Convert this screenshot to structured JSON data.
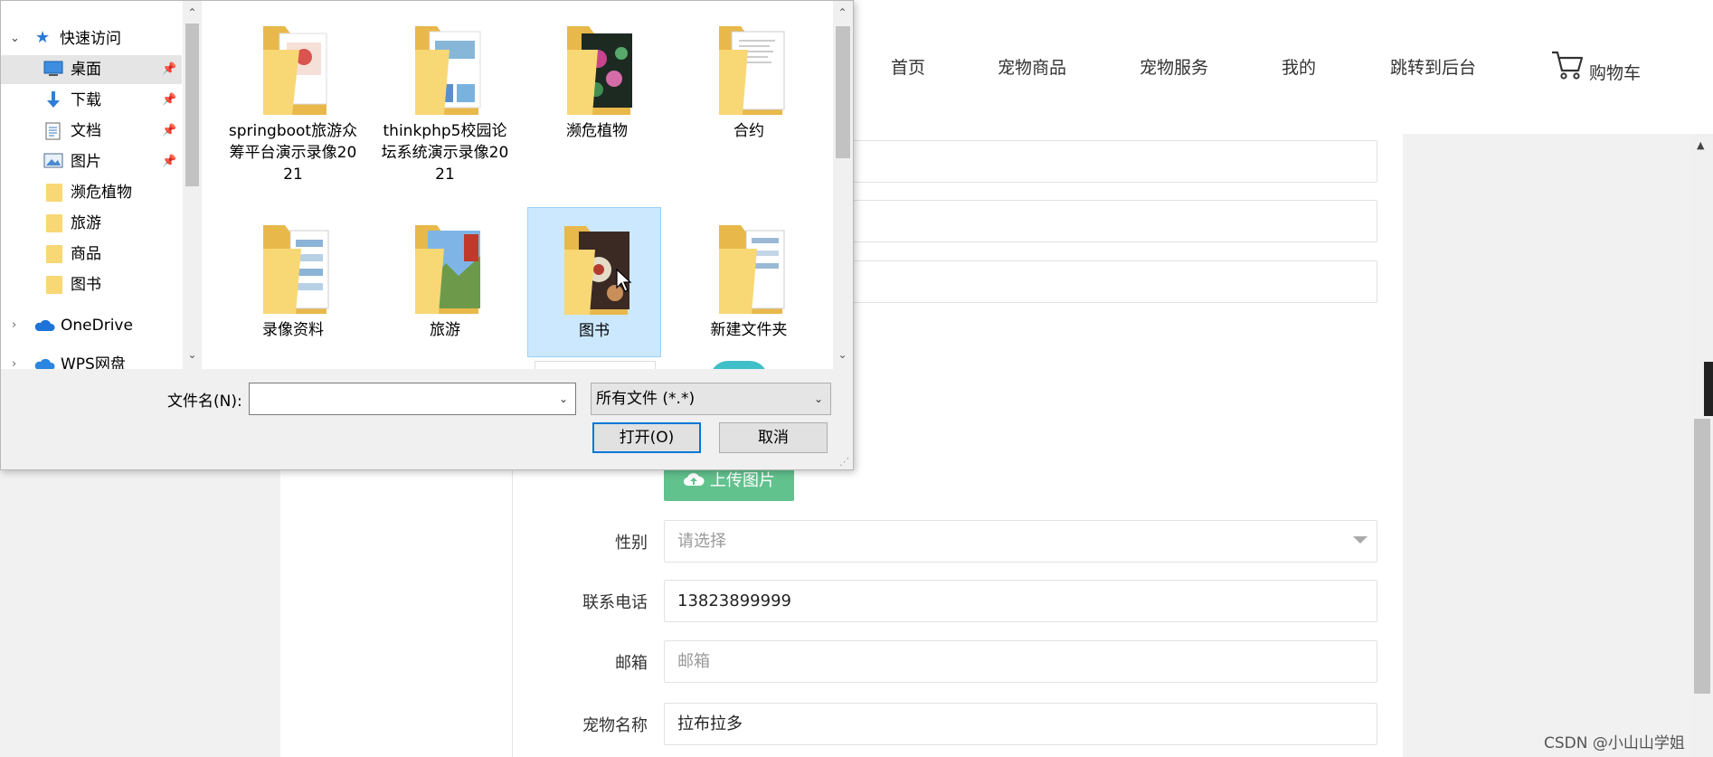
{
  "header": {
    "nav": [
      "首页",
      "宠物商品",
      "宠物服务",
      "我的",
      "跳转到后台"
    ],
    "cart_label": "购物车"
  },
  "form": {
    "upload_label": "上传图片",
    "gender": {
      "label": "性别",
      "placeholder": "请选择"
    },
    "phone": {
      "label": "联系电话",
      "value": "13823899999"
    },
    "email": {
      "label": "邮箱",
      "placeholder": "邮箱"
    },
    "pet_name": {
      "label": "宠物名称",
      "value": "拉布拉多"
    }
  },
  "watermark": "CSDN @小山山学姐",
  "dialog": {
    "quick_access": "快速访问",
    "tree": [
      {
        "label": "桌面",
        "icon": "desktop-icon",
        "pinned": true,
        "selected": true
      },
      {
        "label": "下载",
        "icon": "download-icon",
        "pinned": true
      },
      {
        "label": "文档",
        "icon": "document-icon",
        "pinned": true
      },
      {
        "label": "图片",
        "icon": "picture-icon",
        "pinned": true
      },
      {
        "label": "濒危植物",
        "icon": "folder-icon"
      },
      {
        "label": "旅游",
        "icon": "folder-icon"
      },
      {
        "label": "商品",
        "icon": "folder-icon"
      },
      {
        "label": "图书",
        "icon": "folder-icon"
      }
    ],
    "onedrive": "OneDrive",
    "wps": "WPS网盘",
    "files": [
      {
        "label": "springboot旅游众筹平台演示录像2021"
      },
      {
        "label": "thinkphp5校园论坛系统演示录像2021"
      },
      {
        "label": "濒危植物"
      },
      {
        "label": "合约"
      },
      {
        "label": "录像资料"
      },
      {
        "label": "旅游"
      },
      {
        "label": "图书",
        "selected": true
      },
      {
        "label": "新建文件夹"
      }
    ],
    "filename_label": "文件名(N):",
    "filename_value": "",
    "filetype": "所有文件 (*.*)",
    "open_label": "打开(O)",
    "cancel_label": "取消"
  },
  "colors": {
    "upload_button": "#62c28e",
    "selected_file": "#cce8ff",
    "folder": "#f8d775",
    "accent": "#0078d7"
  }
}
